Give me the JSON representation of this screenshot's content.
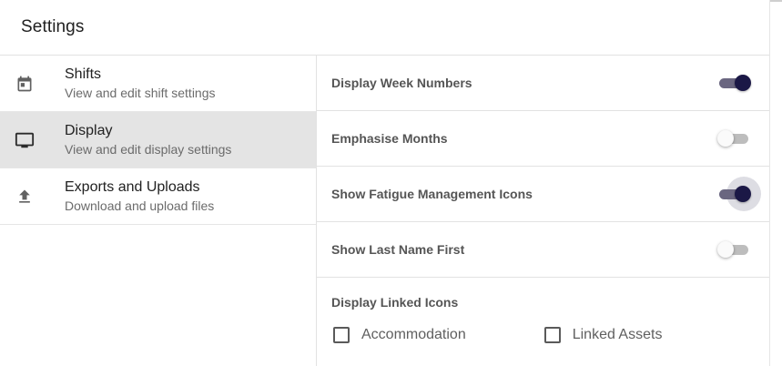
{
  "dialog": {
    "title": "Settings"
  },
  "sidebar": {
    "items": [
      {
        "label": "Shifts",
        "description": "View and edit shift settings",
        "icon": "calendar-icon",
        "active": false
      },
      {
        "label": "Display",
        "description": "View and edit display settings",
        "icon": "monitor-icon",
        "active": true
      },
      {
        "label": "Exports and Uploads",
        "description": "Download and upload files",
        "icon": "upload-icon",
        "active": false
      }
    ]
  },
  "display": {
    "settings": [
      {
        "label": "Display Week Numbers",
        "enabled": true
      },
      {
        "label": "Emphasise Months",
        "enabled": false
      },
      {
        "label": "Show Fatigue Management Icons",
        "enabled": true
      },
      {
        "label": "Show Last Name First",
        "enabled": false
      }
    ],
    "linked_icons": {
      "title": "Display Linked Icons",
      "options": [
        {
          "label": "Accommodation",
          "checked": false
        },
        {
          "label": "Linked Assets",
          "checked": false
        }
      ]
    }
  },
  "colors": {
    "toggle_on_thumb": "#1b1846",
    "toggle_on_track": "#6a6680",
    "active_nav_bg": "#e4e4e4"
  }
}
